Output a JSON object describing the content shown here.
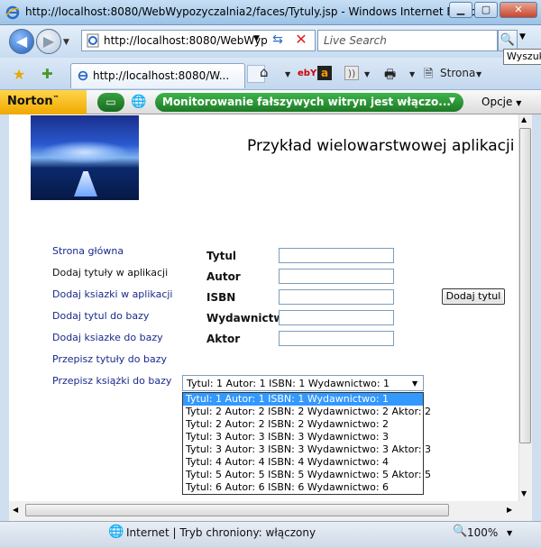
{
  "window": {
    "title": "http://localhost:8080/WebWypozyczalnia2/faces/Tytuly.jsp - Windows Internet Explorer",
    "minimize": "▁",
    "maximize": "▢",
    "close": "✕"
  },
  "nav": {
    "address": "http://localhost:8080/WebWyp",
    "search_placeholder": "Live Search",
    "search_tooltip": "Wyszuk"
  },
  "tab": {
    "label": "http://localhost:8080/W...",
    "strona": "Strona"
  },
  "norton": {
    "brand": "Norton",
    "phishing_status": "Monitorowanie fałszywych witryn jest włączo...",
    "options": "Opcje"
  },
  "page": {
    "title": "Przykład wielowarstwowej aplikacji",
    "nav_links": [
      "Strona główna",
      "Dodaj tytuły w aplikacji",
      "Dodaj ksiazki w aplikacji",
      "Dodaj tytul do bazy",
      "Dodaj ksiazke do bazy",
      "Przepisz tytuły do bazy",
      "Przepisz książki do bazy"
    ],
    "form_labels": [
      "Tytul",
      "Autor",
      "ISBN",
      "Wydawnictwo",
      "Aktor"
    ],
    "add_button": "Dodaj tytul",
    "select_value": "Tytul: 1 Autor: 1 ISBN: 1 Wydawnictwo: 1",
    "options": [
      "Tytul: 1 Autor: 1 ISBN: 1 Wydawnictwo: 1",
      "Tytul: 2 Autor: 2 ISBN: 2 Wydawnictwo: 2 Aktor: 2",
      "Tytul: 2 Autor: 2 ISBN: 2 Wydawnictwo: 2",
      "Tytul: 3 Autor: 3 ISBN: 3 Wydawnictwo: 3",
      "Tytul: 3 Autor: 3 ISBN: 3 Wydawnictwo: 3 Aktor: 3",
      "Tytul: 4 Autor: 4 ISBN: 4 Wydawnictwo: 4",
      "Tytul: 5 Autor: 5 ISBN: 5 Wydawnictwo: 5 Aktor: 5",
      "Tytul: 6 Autor: 6 ISBN: 6 Wydawnictwo: 6"
    ]
  },
  "status": {
    "zone": "Internet | Tryb chroniony: włączony",
    "zoom": "100%"
  }
}
